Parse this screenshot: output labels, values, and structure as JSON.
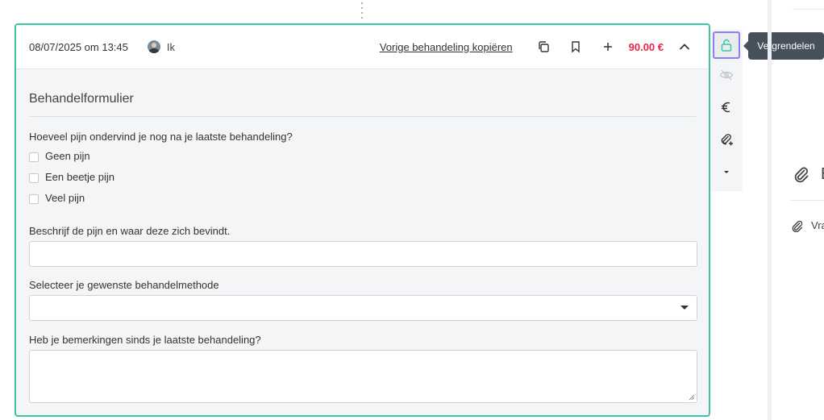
{
  "header": {
    "datetime": "08/07/2025 om 13:45",
    "user_name": "Ik",
    "copy_link": "Vorige behandeling kopiëren",
    "price": "90.00 €"
  },
  "form": {
    "section_title": "Behandelformulier",
    "q1_label": "Hoeveel pijn ondervind je nog na je laatste behandeling?",
    "q1_options": [
      "Geen pijn",
      "Een beetje pijn",
      "Veel pijn"
    ],
    "q2_label": "Beschrijf de pijn en waar deze zich bevindt.",
    "q2_value": "",
    "q3_label": "Selecteer je gewenste behandelmethode",
    "q3_value": "",
    "q4_label": "Heb je bemerkingen sinds je laatste behandeling?",
    "q4_value": ""
  },
  "side_tools": {
    "lock_tooltip": "Vergrendelen",
    "currency_symbol": "€"
  },
  "right_panel": {
    "big_letter": "B",
    "small_text": "Vra"
  },
  "colors": {
    "accent_border": "#3cc4a4",
    "price": "#e8254a",
    "lock_highlight": "#8c7ff0",
    "tooltip_bg": "#46515c"
  }
}
